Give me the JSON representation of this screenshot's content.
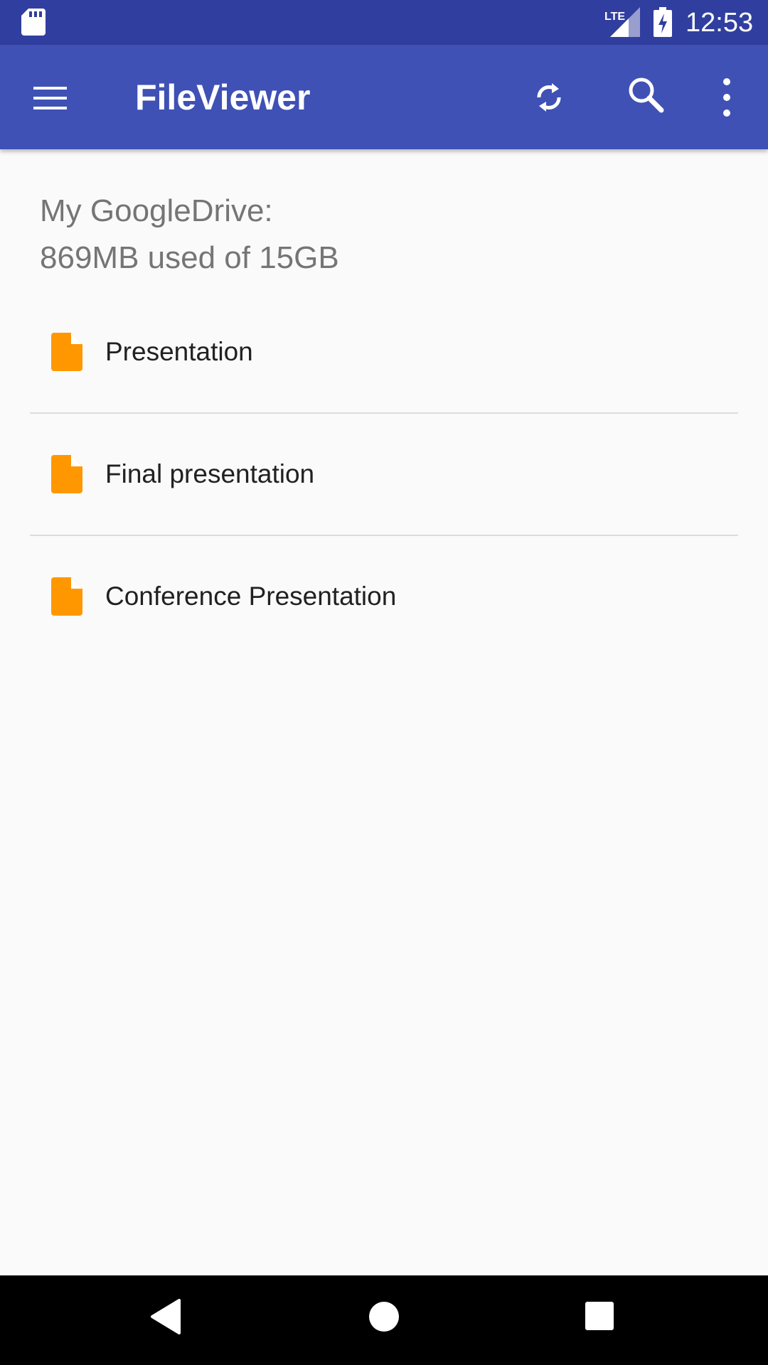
{
  "status_bar": {
    "time": "12:53",
    "network_label": "LTE",
    "icons": [
      "sd-card-icon",
      "lte-signal-icon",
      "battery-charging-icon"
    ]
  },
  "app_bar": {
    "title": "FileViewer",
    "background_color": "#3f51b5",
    "icons": [
      "menu-icon",
      "sync-icon",
      "search-icon",
      "more-vert-icon"
    ]
  },
  "drive": {
    "label": "My GoogleDrive:",
    "usage": "869MB used of 15GB"
  },
  "files": [
    {
      "name": "Presentation",
      "icon": "file-icon",
      "icon_color": "#ff9800"
    },
    {
      "name": "Final presentation",
      "icon": "file-icon",
      "icon_color": "#ff9800"
    },
    {
      "name": "Conference Presentation",
      "icon": "file-icon",
      "icon_color": "#ff9800"
    }
  ],
  "nav_bar": {
    "icons": [
      "back-icon",
      "home-icon",
      "recents-icon"
    ]
  }
}
